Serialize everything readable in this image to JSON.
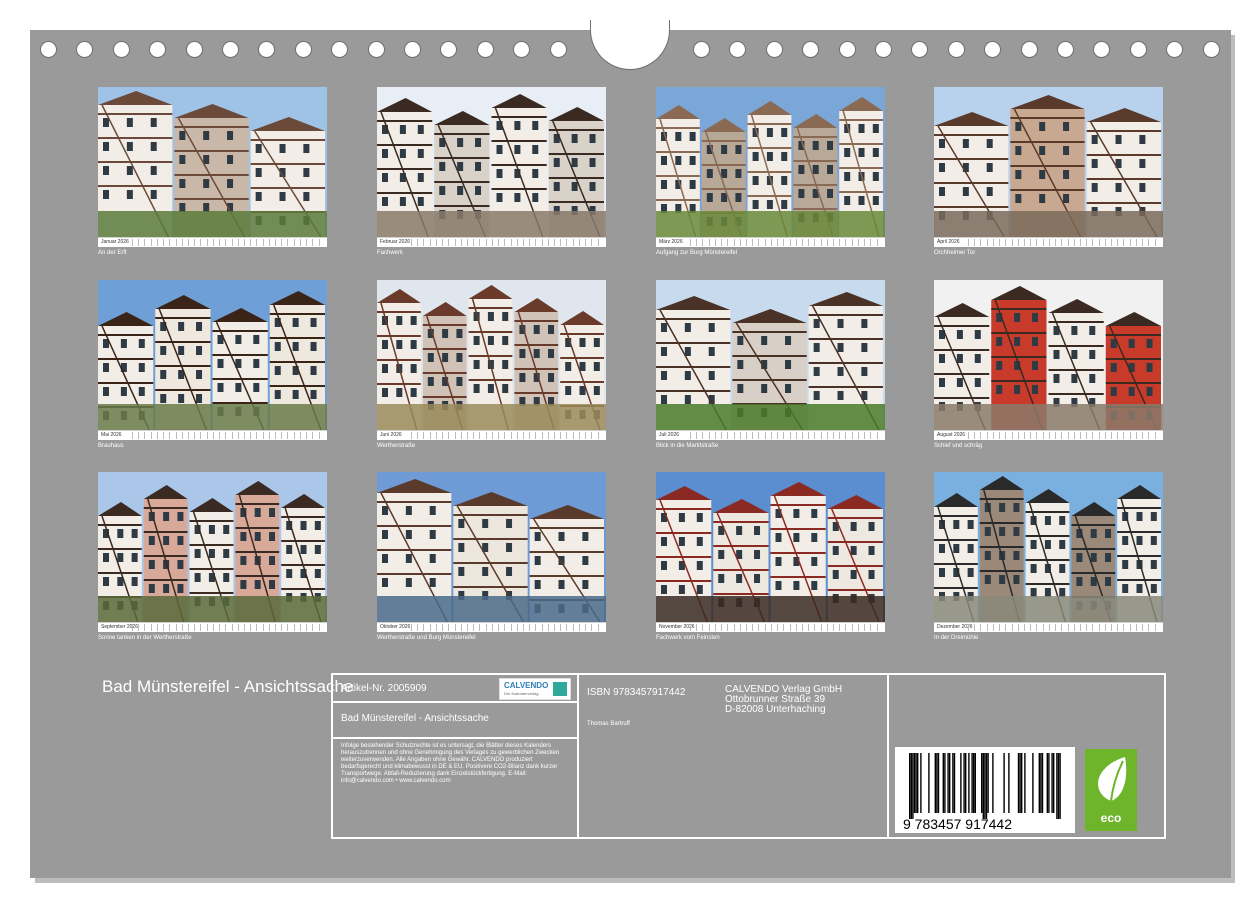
{
  "product": {
    "title": "Bad Münstereifel - Ansichtssache",
    "article_label": "Artikel-Nr. 2005909",
    "isbn": "ISBN 9783457917442",
    "author": "Thomas Bartruff",
    "publisher": [
      "CALVENDO Verlag GmbH",
      "Ottobrunner Straße 39",
      "D-82008 Unterhaching"
    ],
    "legal_text": "Infolge bestehender Schutzrechte ist es untersagt, die Blätter dieses Kalenders herauszutrennen und ohne Genehmigung des Verlages zu gewerblichen Zwecken weiterzuverwenden. Alle Angaben ohne Gewähr. CALVENDO produziert bedarfsgerecht und klimabewusst in DE & EU. Positivere CO2-Bilanz dank kurzer Transportwege. Abfall-Reduzierung dank Einzelstückfertigung. E-Mail: info@calvendo.com • www.calvendo.com",
    "barcode_digits": "9 783457 917442",
    "logo_text": "CALVENDO",
    "logo_subtext": "Der Kalenderverlag",
    "eco_label": "eco"
  },
  "colors": {
    "sheet": "#9a9a9a",
    "eco_green": "#6fb52c",
    "logo_blue": "#2a7fb8"
  },
  "months": [
    {
      "name": "Januar 2026",
      "caption": "An der Erft"
    },
    {
      "name": "Februar 2026",
      "caption": "Fachwerk"
    },
    {
      "name": "März 2026",
      "caption": "Aufgang zur Burg Münstereifel"
    },
    {
      "name": "April 2026",
      "caption": "Orchheimer Tor"
    },
    {
      "name": "Mai 2026",
      "caption": "Brauhaus"
    },
    {
      "name": "Juni 2026",
      "caption": "Wertherstraße"
    },
    {
      "name": "Juli 2026",
      "caption": "Blick in die Marktstraße"
    },
    {
      "name": "August 2026",
      "caption": "Schief und schräg"
    },
    {
      "name": "September 2026",
      "caption": "Sonne tanken in der Wertherstraße"
    },
    {
      "name": "Oktober 2026",
      "caption": "Wertherstraße und Burg Münstereifel"
    },
    {
      "name": "November 2026",
      "caption": "Fachwerk vom Feinsten"
    },
    {
      "name": "Dezember 2026",
      "caption": "In der Dreimühle"
    }
  ]
}
